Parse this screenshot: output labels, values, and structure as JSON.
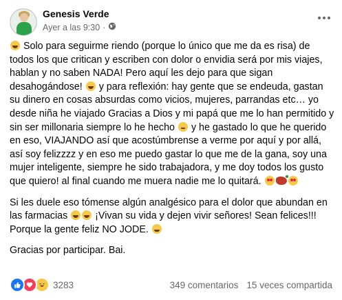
{
  "post": {
    "author": "Genesis Verde",
    "timestamp": "Ayer a las 9:30",
    "audience_icon": "globe-icon",
    "more_icon": "more-options-icon",
    "paragraphs": [
      {
        "segments": [
          {
            "emoji": "grinning-squinting-face"
          },
          {
            "text": " Solo para seguirme riendo (porque lo único que me da es risa) de todos los que critican y escriben con dolor o envidia será por mis viajes, hablan y no saben NADA! Pero aquí les dejo para que sigan desahogándose! "
          },
          {
            "emoji": "rolling-laughing-face"
          },
          {
            "text": " y para reflexión: hay gente que se endeuda, gastan su dinero en cosas absurdas como vicios, mujeres, parrandas etc… yo desde niña he viajado Gracias a Dios y mi papá que me lo han permitido y sin ser millonaria siempre lo he hecho "
          },
          {
            "emoji": "winking-face"
          },
          {
            "text": " y he gastado lo que he querido en eso, VIAJANDO así que acostúmbrense a verme por aquí y por allá, así soy felizzzz y en eso me puedo gastar lo que me de la gana, soy una mujer inteligente, siempre he sido trabajadora, y me doy todos los gusto que quiero! al final cuando me muera nadie me lo quitará. "
          },
          {
            "emoji": "heart-eyes-face"
          },
          {
            "emoji": "chili-pepper"
          },
          {
            "emoji": "smiling-face-with-hearts"
          }
        ]
      },
      {
        "segments": [
          {
            "text": "Si les duele eso tómense algún analgésico para el dolor que abundan en las farmacias "
          },
          {
            "emoji": "grinning-squinting-face"
          },
          {
            "emoji": "grinning-face"
          },
          {
            "text": " ¡Vivan su vida y dejen vivir señores! Sean felices!!! Porque la gente feliz NO JODE. "
          },
          {
            "emoji": "face-with-tears-of-joy"
          }
        ]
      },
      {
        "segments": [
          {
            "text": "Gracias por participar. Bai."
          }
        ]
      }
    ]
  },
  "footer": {
    "reactions": [
      "like",
      "love",
      "haha"
    ],
    "reaction_count": "3283",
    "comments": "349 comentarios",
    "shares": "15 veces compartida"
  }
}
